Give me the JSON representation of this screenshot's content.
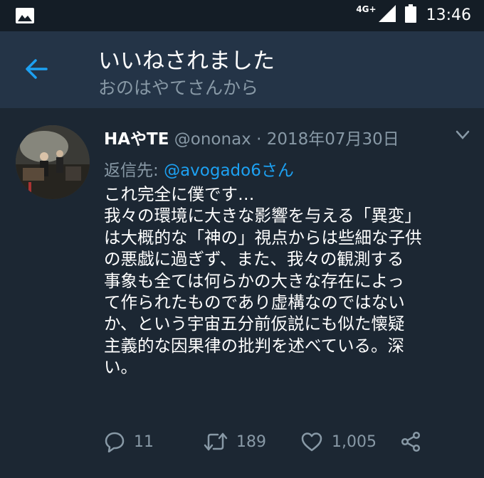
{
  "status_bar": {
    "network": "4G+",
    "time": "13:46",
    "icons": [
      "image-icon",
      "signal-icon",
      "battery-icon"
    ]
  },
  "header": {
    "title": "いいねされました",
    "subtitle": "おのはやてさんから",
    "back_icon": "back-arrow-icon"
  },
  "tweet": {
    "name": "HAやTE",
    "handle": "@ononax",
    "separator": "·",
    "date": "2018年07月30日",
    "reply_prefix": "返信先: ",
    "reply_mention": "@avogado6",
    "reply_suffix": "さん",
    "text": "これ完全に僕です…\n我々の環境に大きな影響を与える「異変」\nは大概的な「神の」視点からは些細な子供\nの悪戯に過ぎず、また、我々の観測する\n事象も全ては何らかの大きな存在によっ\nて作られたものであり虚構なのではない\nか、という宇宙五分前仮説にも似た懐疑\n主義的な因果律の批判を述べている。深\nい。",
    "replies": "11",
    "retweets": "189",
    "likes": "1,005"
  },
  "colors": {
    "background": "#1c2733",
    "header_bg": "#243447",
    "status_bg": "#141d26",
    "accent": "#1da1f2",
    "muted": "#8899a6"
  }
}
